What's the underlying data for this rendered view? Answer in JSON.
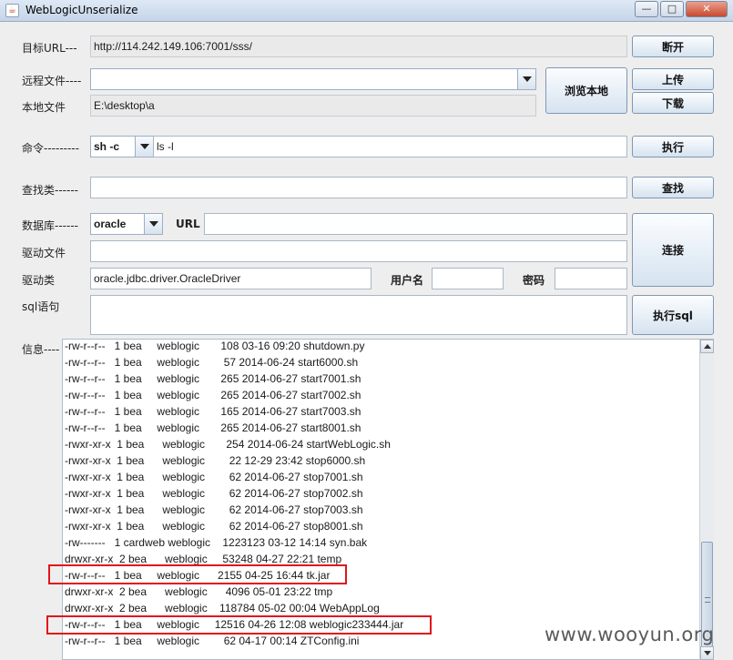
{
  "window": {
    "title": "WebLogicUnserialize",
    "icon": "java-cup-icon",
    "buttons": {
      "minimize": "—",
      "maximize": "□",
      "close": "✕"
    }
  },
  "target": {
    "label": "目标URL---",
    "value": "http://114.242.149.106:7001/sss/",
    "disconnect_label": "断开"
  },
  "remote": {
    "label": "远程文件----",
    "value": "",
    "browse_label": "浏览本地",
    "upload_label": "上传",
    "download_label": "下载"
  },
  "local": {
    "label": "本地文件",
    "value": "E:\\desktop\\a"
  },
  "command": {
    "label": "命令---------",
    "shell": "sh -c",
    "value": "ls -l",
    "exec_label": "执行"
  },
  "find": {
    "label": "查找类------",
    "value": "",
    "button_label": "查找"
  },
  "database": {
    "label": "数据库------",
    "type": "oracle",
    "url_label": "URL",
    "url_value": "",
    "driver_file_label": "驱动文件",
    "driver_file_value": "",
    "driver_class_label": "驱动类",
    "driver_class_value": "oracle.jdbc.driver.OracleDriver",
    "username_label": "用户名",
    "username_value": "",
    "password_label": "密码",
    "password_value": "",
    "connect_label": "连接",
    "sql_label": "sql语句",
    "sql_value": "",
    "exec_sql_label": "执行sql"
  },
  "info": {
    "label": "信息----",
    "lines": [
      "-rw-r--r--   1 bea     weblogic       108 03-16 09:20 shutdown.py",
      "-rw-r--r--   1 bea     weblogic        57 2014-06-24 start6000.sh",
      "-rw-r--r--   1 bea     weblogic       265 2014-06-27 start7001.sh",
      "-rw-r--r--   1 bea     weblogic       265 2014-06-27 start7002.sh",
      "-rw-r--r--   1 bea     weblogic       165 2014-06-27 start7003.sh",
      "-rw-r--r--   1 bea     weblogic       265 2014-06-27 start8001.sh",
      "-rwxr-xr-x  1 bea      weblogic       254 2014-06-24 startWebLogic.sh",
      "-rwxr-xr-x  1 bea      weblogic        22 12-29 23:42 stop6000.sh",
      "-rwxr-xr-x  1 bea      weblogic        62 2014-06-27 stop7001.sh",
      "-rwxr-xr-x  1 bea      weblogic        62 2014-06-27 stop7002.sh",
      "-rwxr-xr-x  1 bea      weblogic        62 2014-06-27 stop7003.sh",
      "-rwxr-xr-x  1 bea      weblogic        62 2014-06-27 stop8001.sh",
      "-rw-------   1 cardweb weblogic    1223123 03-12 14:14 syn.bak",
      "drwxr-xr-x  2 bea      weblogic     53248 04-27 22:21 temp",
      "-rw-r--r--   1 bea     weblogic      2155 04-25 16:44 tk.jar",
      "drwxr-xr-x  2 bea      weblogic      4096 05-01 23:22 tmp",
      "drwxr-xr-x  2 bea      weblogic    118784 05-02 00:04 WebAppLog",
      "-rw-r--r--   1 bea     weblogic     12516 04-26 12:08 weblogic233444.jar",
      "-rw-r--r--   1 bea     weblogic        62 04-17 00:14 ZTConfig.ini"
    ],
    "highlighted_line_indices": [
      14,
      17
    ],
    "highlight_color": "#e0151b"
  },
  "watermark": "www.wooyun.org"
}
